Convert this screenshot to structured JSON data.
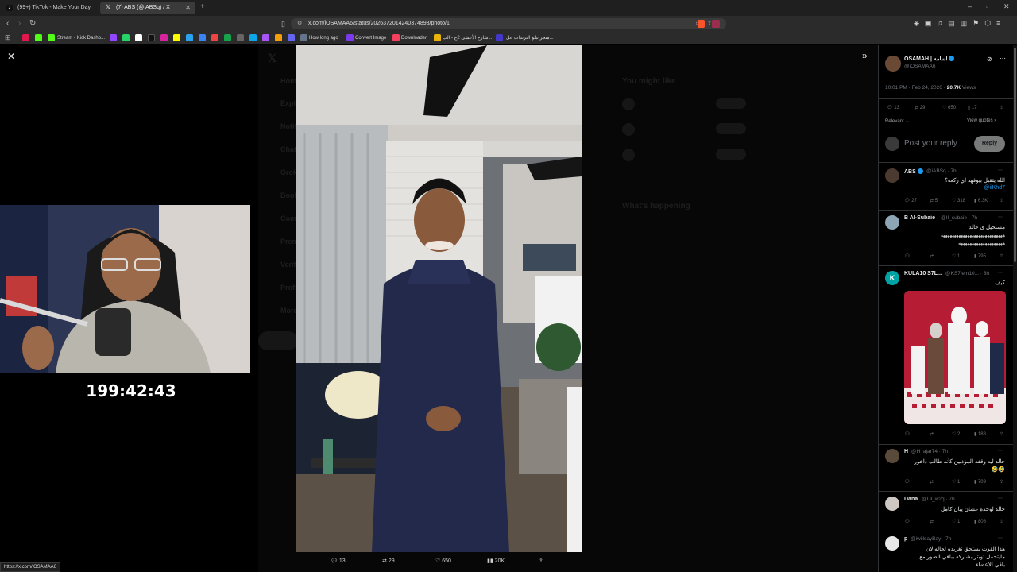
{
  "browser": {
    "tabs": [
      {
        "title": "(99+) TikTok - Make Your Day",
        "active": false
      },
      {
        "title": "(7) ABS (@iABSq) / X",
        "active": true
      }
    ],
    "new_tab": "+",
    "url": "x.com/iOSAMAA6/status/2026372014240374893/photo/1",
    "status_url": "https://x.com/iOSAMAA6",
    "bookmarks": [
      "Stream - Kick Dashb...",
      "How long ago",
      "Convert Image",
      "Downloader",
      "شارع الأعشى 2ع - الب...",
      "متجر تبلو الترندات عل..."
    ]
  },
  "stream": {
    "timer": "199:42:43"
  },
  "photo_actions": {
    "replies": "13",
    "reposts": "29",
    "likes": "650",
    "views": "20K"
  },
  "post": {
    "author_name": "OSAMAH | اسامه",
    "author_handle": "@iOSAMAA6",
    "time": "10:01 PM · Feb 24, 2026 ·",
    "views": "20.7K",
    "views_label": "Views",
    "replies": "13",
    "reposts": "29",
    "likes": "650",
    "bookmarks": "17",
    "sort_label": "Relevant",
    "view_quotes": "View quotes",
    "reply_placeholder": "Post your reply",
    "reply_button": "Reply"
  },
  "replies": [
    {
      "name": "ABS",
      "handle": "@iABSq · 7h",
      "text": "الله يتقبل بيوفهد اي ركعه؟",
      "mention": "@iiKhd7",
      "replies": "27",
      "reposts": "5",
      "likes": "318",
      "views": "6.3K"
    },
    {
      "name": "B Al-Subaie",
      "handle": "@II_subaie · 7h",
      "text": "مستحيل ي خالد",
      "text2": "ههههههههههههههههههههههههههههه",
      "text3": "ههههههههههههههههههههه",
      "replies": "",
      "reposts": "",
      "likes": "1",
      "views": "795"
    },
    {
      "name": "KULA10 S7L...",
      "handle": "@KS7lem10... · 3h",
      "text": "كيف",
      "replies": "",
      "reposts": "",
      "likes": "2",
      "views": "188"
    },
    {
      "name": "H",
      "handle": "@H_ajar74 · 7h",
      "text": "خالد ليه وقفه المؤذبين كأنه طالب داخور",
      "text2": "🤣🤣",
      "replies": "",
      "reposts": "",
      "likes": "1",
      "views": "709"
    },
    {
      "name": "Dana",
      "handle": "@Lil_w2q · 7h",
      "text": "خالد لوحده عشان يبان كامل",
      "replies": "",
      "reposts": "",
      "likes": "1",
      "views": "808"
    },
    {
      "name": "p",
      "handle": "@iwillsayBay · 7h",
      "text": "هذا القوت يستحق تغريده لحاله لان",
      "text2": "مايتحمل تويتر بشاركه بباقي الصور مع",
      "text3": "باقي الاعضاء"
    }
  ],
  "ghost_menu": [
    "Home",
    "Explore",
    "Notifications",
    "Chat",
    "Grok",
    "Bookmarks",
    "Communities",
    "Premium",
    "Verified Orgs",
    "Profile",
    "More"
  ],
  "ghost_right": {
    "you_might_like": "You might like",
    "whats_happening": "What's happening"
  },
  "colors": {
    "accent": "#1d9bf0",
    "bg": "#000000",
    "muted": "#71767b"
  }
}
